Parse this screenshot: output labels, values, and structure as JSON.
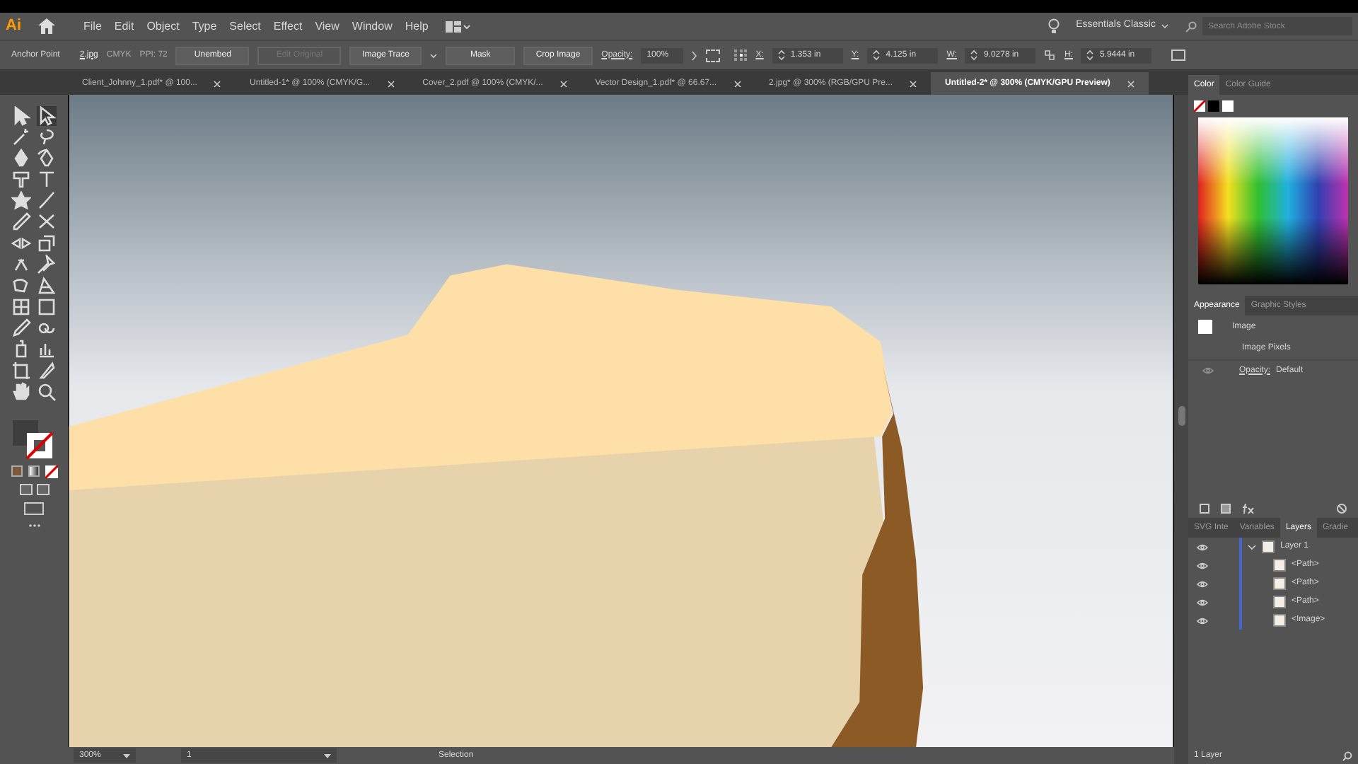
{
  "app_logo": "Ai",
  "menu": [
    "File",
    "Edit",
    "Object",
    "Type",
    "Select",
    "Effect",
    "View",
    "Window",
    "Help"
  ],
  "workspace": "Essentials Classic",
  "stock_search": {
    "placeholder": "Search Adobe Stock"
  },
  "control_bar": {
    "mode": "Anchor Point",
    "file": "2.jpg",
    "color_mode": "CMYK",
    "ppi": "PPI: 72",
    "buttons": [
      {
        "label": "Unembed",
        "disabled": false
      },
      {
        "label": "Edit Original",
        "disabled": true
      }
    ],
    "image_trace": "Image Trace",
    "mask": "Mask",
    "crop": "Crop Image",
    "opacity_label": "Opacity:",
    "opacity": "100%",
    "fields": [
      {
        "label": "X:",
        "value": "1.353 in"
      },
      {
        "label": "Y:",
        "value": "4.125 in"
      },
      {
        "label": "W:",
        "value": "9.0278 in"
      },
      {
        "label": "H:",
        "value": "5.9444 in"
      }
    ]
  },
  "tabs": [
    {
      "label": "Client_Johnny_1.pdf* @ 100...",
      "selected": false
    },
    {
      "label": "Untitled-1* @ 100% (CMYK/G...",
      "selected": false
    },
    {
      "label": "Cover_2.pdf @ 100% (CMYK/...",
      "selected": false
    },
    {
      "label": "Vector Design_1.pdf* @ 66.67...",
      "selected": false
    },
    {
      "label": "2.jpg* @ 300% (RGB/GPU Pre...",
      "selected": false
    },
    {
      "label": "Untitled-2* @ 300% (CMYK/GPU Preview)",
      "selected": true
    }
  ],
  "color_panel": {
    "tabs": [
      {
        "label": "Color",
        "selected": true
      },
      {
        "label": "Color Guide",
        "selected": false
      }
    ]
  },
  "appearance_panel": {
    "tabs": [
      {
        "label": "Appearance",
        "selected": true
      },
      {
        "label": "Graphic Styles",
        "selected": false
      }
    ],
    "object": "Image",
    "rows": [
      "Image Pixels"
    ],
    "opacity_label": "Opacity:",
    "opacity": "Default"
  },
  "layers_panel": {
    "tabs": [
      {
        "label": "SVG Inte",
        "selected": false
      },
      {
        "label": "Variables",
        "selected": false
      },
      {
        "label": "Layers",
        "selected": true
      },
      {
        "label": "Gradie",
        "selected": false
      }
    ],
    "layers": [
      {
        "name": "Layer 1",
        "visible": true,
        "expanded": true,
        "children": [
          {
            "name": "<Path>",
            "visible": true
          },
          {
            "name": "<Path>",
            "visible": true
          },
          {
            "name": "<Path>",
            "visible": true
          },
          {
            "name": "<Image>",
            "visible": true
          }
        ]
      }
    ],
    "count": "1 Layer"
  },
  "status_bar": {
    "zoom": "300%",
    "artboard": "1",
    "tool": "Selection"
  }
}
